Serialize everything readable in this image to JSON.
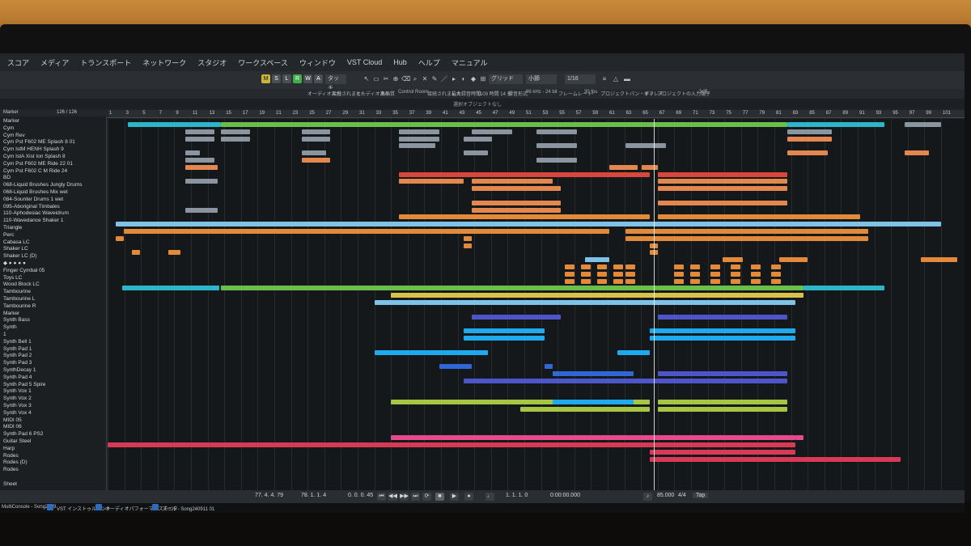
{
  "menubar": {
    "items": [
      "スコア",
      "メディア",
      "トランスポート",
      "ネットワーク",
      "スタジオ",
      "ワークスペース",
      "ウィンドウ",
      "VST Cloud",
      "Hub",
      "ヘルプ",
      "マニュアル"
    ]
  },
  "toolbar": {
    "mode_buttons": [
      "M",
      "S",
      "L",
      "R",
      "W",
      "A"
    ],
    "automation_mode": "タッチ",
    "grid_type": "グリッド",
    "bar_label": "小節",
    "quantize": "1/16"
  },
  "infoline": {
    "items": [
      "オーディオ入力",
      "接続されました",
      "オーディオあり",
      "高画質",
      "Control Room",
      "接続されました",
      "最大録音時間",
      "1109 時間 14 分",
      "録音形式",
      "96 kHz - 24 bit",
      "フレームレート",
      "30 fps",
      "プロジェクトパン・ディレイ",
      "オフ",
      "プロジェクトの入力端子",
      "-3dB"
    ]
  },
  "titlebar": {
    "title": "選択オブジェクトなし"
  },
  "tracklist": {
    "header": "Marker",
    "counter": "126 / 126",
    "tracks": [
      {
        "name": "Marker"
      },
      {
        "name": "Cym"
      },
      {
        "name": "Cym Rev"
      },
      {
        "name": "Cym Pst F602 ME Splash 8 01"
      },
      {
        "name": "Cym IstM HENH Splash 9"
      },
      {
        "name": "Cym IstA Xist Ion Splash 8"
      },
      {
        "name": "Cym Pst F602 ME Ride 22 01"
      },
      {
        "name": "Cym Pst F602 C M Ride 24"
      },
      {
        "name": "BD"
      },
      {
        "name": "068-Liquid Brushes Jungly Drums"
      },
      {
        "name": "068-Liquid Brushes Mix wet"
      },
      {
        "name": "084-Sounter Drums 1 wet"
      },
      {
        "name": "095-Aboriginal Timbales"
      },
      {
        "name": "110-Aphodesiac Waveidrum"
      },
      {
        "name": "110-Wavedance Shaker 1"
      },
      {
        "name": "Triangle"
      },
      {
        "name": "Perc"
      },
      {
        "name": "Cabasa LC"
      },
      {
        "name": "Shaker LC"
      },
      {
        "name": "Shaker LC (D)"
      },
      {
        "name": "◆ ● ● ● ●"
      },
      {
        "name": "Finger Cymbal 05"
      },
      {
        "name": "Toys LC"
      },
      {
        "name": "Wood Block LC"
      },
      {
        "name": "Tambourine"
      },
      {
        "name": "Tambourine L"
      },
      {
        "name": "Tambourine R"
      },
      {
        "name": "Marker"
      },
      {
        "name": "Synth Bass"
      },
      {
        "name": "Synth"
      },
      {
        "name": "1"
      },
      {
        "name": "Synth Bell 1"
      },
      {
        "name": "Synth Pad 1"
      },
      {
        "name": "Synth Pad 2"
      },
      {
        "name": "Synth Pad 3"
      },
      {
        "name": "SynthDecay 1"
      },
      {
        "name": "Synth Pad 4"
      },
      {
        "name": "Synth Pad 5 Spire"
      },
      {
        "name": "Synth Vox 1"
      },
      {
        "name": "Synth Vox 2"
      },
      {
        "name": "Synth Vox 3"
      },
      {
        "name": "Synth Vox 4"
      },
      {
        "name": "MIDI 05"
      },
      {
        "name": "MIDI 06"
      },
      {
        "name": "Synth Pad 6 PS2"
      },
      {
        "name": "Guitar Steel"
      },
      {
        "name": "Harp"
      },
      {
        "name": "Rodes"
      },
      {
        "name": "Rodes (D)"
      },
      {
        "name": "Rodes"
      },
      {
        "name": ""
      },
      {
        "name": "Sheet"
      }
    ]
  },
  "ruler": {
    "bars": [
      "1",
      "3",
      "5",
      "7",
      "9",
      "11",
      "13",
      "15",
      "17",
      "19",
      "21",
      "23",
      "25",
      "27",
      "29",
      "31",
      "33",
      "35",
      "37",
      "39",
      "41",
      "43",
      "45",
      "47",
      "49",
      "51",
      "53",
      "55",
      "57",
      "59",
      "61",
      "63",
      "65",
      "67",
      "69",
      "71",
      "73",
      "75",
      "77",
      "79",
      "81",
      "83",
      "85",
      "87",
      "89",
      "91",
      "93",
      "95",
      "97",
      "99",
      "101"
    ]
  },
  "colors": {
    "cyan": "#2bb6c9",
    "green": "#6abf4b",
    "orange": "#e28a3a",
    "salmon": "#e3874f",
    "red": "#d9473c",
    "yellow": "#d8c24a",
    "lightblue": "#7ec3e6",
    "blue": "#2f68d6",
    "indigo": "#4d55c9",
    "skyblue": "#1fa9ef",
    "lime": "#a6c542",
    "pink": "#e54a8a",
    "crimson": "#d63a55",
    "gray": "#8b95a0"
  },
  "transport": {
    "left_locator": "77. 4. 4. 79",
    "right_locator": "78. 1. 1. 4",
    "offset": "0. 0. 0. 45",
    "position_bars": "1. 1. 1. 0",
    "position_time": "0:00:00.000",
    "tempo": "85.000",
    "signature": "4/4",
    "tap_label": "Tap"
  },
  "taskbar": {
    "items": [
      "MultiConsole - Song2409",
      "VST インストゥルメント",
      "オーディオパフォーマンスモニタ",
      "プール - Song240911 01"
    ]
  }
}
